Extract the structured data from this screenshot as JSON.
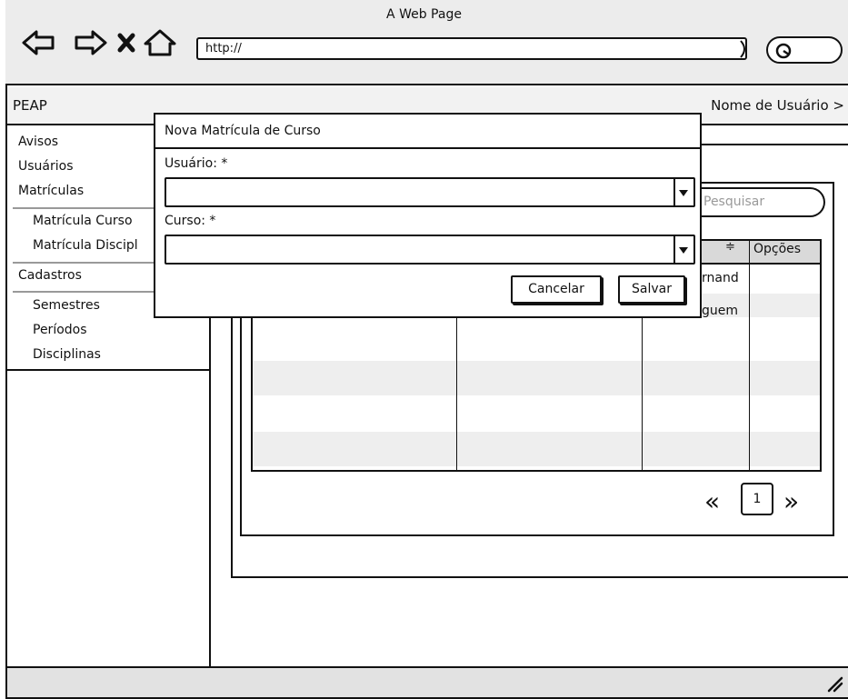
{
  "browser": {
    "title": "A Web Page",
    "url": "http://"
  },
  "app": {
    "brand": "PEAP",
    "user_menu": "Nome de Usuário >"
  },
  "sidebar": {
    "items": [
      {
        "label": "Avisos"
      },
      {
        "label": "Usuários"
      },
      {
        "label": "Matrículas"
      },
      {
        "label": "Matrícula Curso"
      },
      {
        "label": "Matrícula Discipl"
      },
      {
        "label": "Cadastros"
      },
      {
        "label": "Semestres"
      },
      {
        "label": "Períodos"
      },
      {
        "label": "Disciplinas"
      }
    ]
  },
  "main": {
    "search_button": "Pesquisar",
    "table": {
      "headers": [
        "",
        "",
        "≑",
        "Opções"
      ],
      "rows": [
        {
          "partial": "rnand"
        },
        {
          "partial": "guem"
        }
      ]
    },
    "pagination": {
      "prev": "«",
      "page": "1",
      "next": "»"
    }
  },
  "dialog": {
    "title": "Nova Matrícula de Curso",
    "fields": [
      {
        "label": "Usuário: *",
        "value": ""
      },
      {
        "label": "Curso: *",
        "value": ""
      }
    ],
    "cancel_label": "Cancelar",
    "save_label": "Salvar"
  }
}
